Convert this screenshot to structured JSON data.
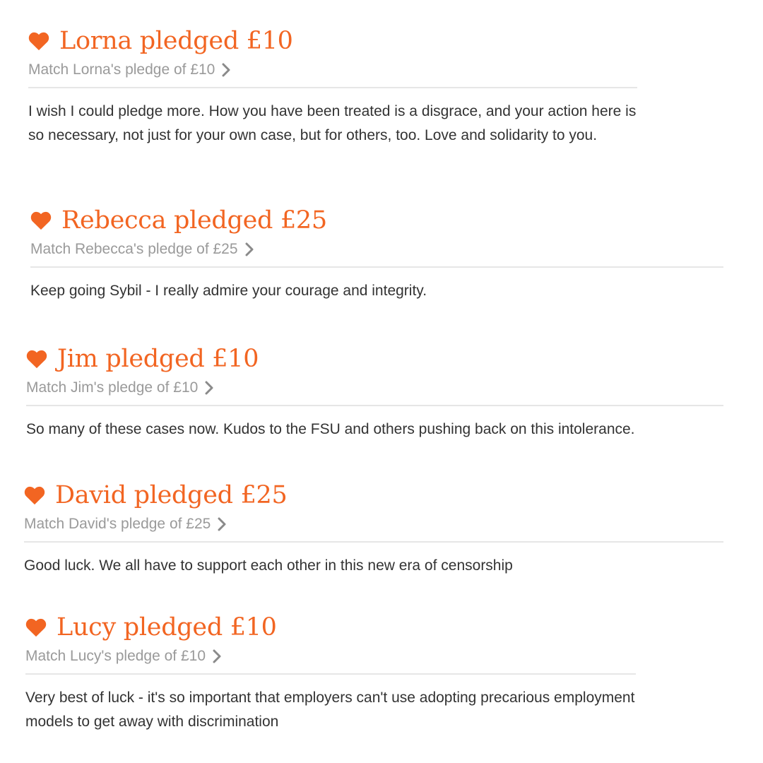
{
  "theme": {
    "accent": "#f26522",
    "muted": "#9a9a9a",
    "text": "#333333",
    "divider": "#e6e6e6"
  },
  "icons": {
    "pledge_icon": "heart-icon",
    "match_icon": "chevron-right-icon"
  },
  "pledges": [
    {
      "title": "Lorna pledged £10",
      "match": "Match Lorna's pledge of £10",
      "comment": "I wish I could pledge more. How you have been treated is a disgrace, and your action here is so necessary, not just for your own case, but for others, too. Love and solidarity to you."
    },
    {
      "title": "Rebecca pledged £25",
      "match": "Match Rebecca's pledge of £25",
      "comment": "Keep going Sybil - I really admire your courage and integrity."
    },
    {
      "title": "Jim pledged £10",
      "match": "Match Jim's pledge of £10",
      "comment": "So many of these cases now. Kudos to the FSU and others pushing back on this intolerance."
    },
    {
      "title": "David pledged £25",
      "match": "Match David's pledge of £25",
      "comment": "Good luck. We all have to support each other in this new era of censorship"
    },
    {
      "title": "Lucy pledged £10",
      "match": "Match Lucy's pledge of £10",
      "comment": "Very best of luck - it's so important that employers can't use adopting precarious employment models to get away with discrimination"
    }
  ]
}
